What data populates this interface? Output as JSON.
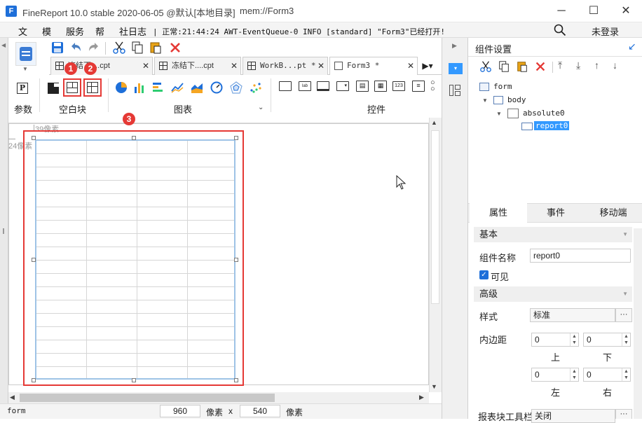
{
  "title": {
    "app": "FineReport 10.0 stable 2020-06-05 @默认[本地目录]",
    "mem": "mem://Form3"
  },
  "window_controls": {
    "minimize": "─",
    "maximize": "☐",
    "close": "✕"
  },
  "menu": {
    "items": [
      "文",
      "模",
      "服务",
      "帮",
      "社日志"
    ],
    "status_line": "| 正常:21:44:24 AWT-EventQueue-0 INFO [standard] \"Form3\"已经打开!",
    "login": "未登录"
  },
  "tabs": [
    {
      "label": "冻结下....cpt",
      "active": false
    },
    {
      "label": "冻结下....cpt",
      "active": false
    },
    {
      "label": "WorkB...pt *",
      "active": false
    },
    {
      "label": "Form3 *",
      "active": true
    }
  ],
  "toolbar": {
    "params_label": "参数",
    "blank_block_label": "空白块",
    "chart_label": "图表",
    "widget_label": "控件",
    "param_icon_text": "P"
  },
  "badges": [
    "1",
    "2",
    "3"
  ],
  "canvas": {
    "ruler_top": "39像素",
    "ruler_left": "24像素"
  },
  "statusbar": {
    "name": "form",
    "width": "960",
    "unit1": "像素",
    "times": "x",
    "height": "540",
    "unit2": "像素"
  },
  "right_panel": {
    "title": "组件设置",
    "tree": {
      "root": "form",
      "body": "body",
      "absolute": "absolute0",
      "report": "report0"
    },
    "tabs": [
      "属性",
      "事件",
      "移动端"
    ],
    "basic_group": "基本",
    "name_label": "组件名称",
    "name_value": "report0",
    "visible_label": "可见",
    "advanced_group": "高级",
    "style_label": "样式",
    "style_value": "标准",
    "padding_label": "内边距",
    "pad_top": "0",
    "pad_bottom": "0",
    "pad_left": "0",
    "pad_right": "0",
    "top_label": "上",
    "bottom_label": "下",
    "left_label": "左",
    "right_label": "右",
    "toolbar_label": "报表块工具栏",
    "toolbar_value": "关闭"
  },
  "colors": {
    "accent": "#1e6fd9",
    "highlight": "#e53935",
    "selection": "#3399ff"
  }
}
